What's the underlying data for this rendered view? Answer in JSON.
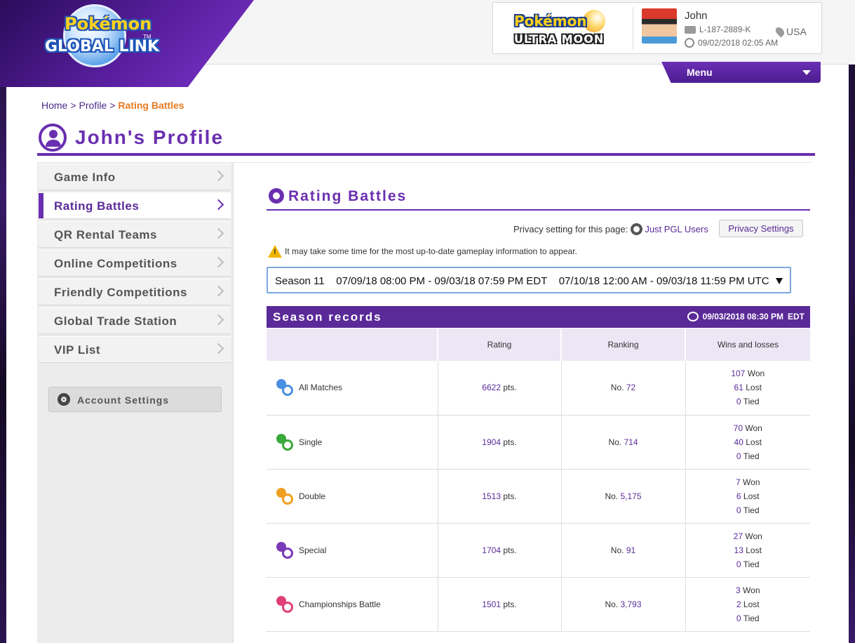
{
  "brand": {
    "logo_line1": "Pokémon",
    "logo_line2": "GLOBAL LINK",
    "logo_tm": "TM",
    "game_line1": "Pokémon",
    "game_line2": "ULTRA MOON"
  },
  "user": {
    "name": "John",
    "id": "L-187-2889-K",
    "country": "USA",
    "timestamp": "09/02/2018 02:05 AM"
  },
  "menu": {
    "label": "Menu"
  },
  "breadcrumb": {
    "home": "Home",
    "profile": "Profile",
    "current": "Rating Battles",
    "sep": ">"
  },
  "profile": {
    "title": "John's Profile"
  },
  "sidebar": {
    "items": [
      {
        "label": "Game Info"
      },
      {
        "label": "Rating Battles"
      },
      {
        "label": "QR Rental Teams"
      },
      {
        "label": "Online Competitions"
      },
      {
        "label": "Friendly Competitions"
      },
      {
        "label": "Global Trade Station"
      },
      {
        "label": "VIP List"
      }
    ],
    "active_index": 1,
    "account_settings": "Account Settings"
  },
  "section": {
    "title": "Rating Battles",
    "privacy_label": "Privacy setting for this page:",
    "privacy_value": "Just PGL Users",
    "privacy_button": "Privacy Settings",
    "warning": "It may take some time for the most up-to-date gameplay information to appear."
  },
  "season": {
    "selected": "Season 11    07/09/18 08:00 PM - 09/03/18 07:59 PM EDT    07/10/18 12:00 AM - 09/03/18 11:59 PM UTC"
  },
  "records": {
    "title": "Season records",
    "stamp_date": "09/03/2018 08:30 PM",
    "stamp_tz": "EDT",
    "columns": [
      "",
      "Rating",
      "Ranking",
      "Wins and losses"
    ],
    "rows": [
      {
        "category": "All Matches",
        "rating": "6622",
        "ranking": "72",
        "won": "107",
        "lost": "61",
        "tied": "0",
        "icon_color": "#4a8fe0"
      },
      {
        "category": "Single",
        "rating": "1904",
        "ranking": "714",
        "won": "70",
        "lost": "40",
        "tied": "0",
        "icon_color": "#3aa83a"
      },
      {
        "category": "Double",
        "rating": "1513",
        "ranking": "5,175",
        "won": "7",
        "lost": "6",
        "tied": "0",
        "icon_color": "#f0a020"
      },
      {
        "category": "Special",
        "rating": "1704",
        "ranking": "91",
        "won": "27",
        "lost": "13",
        "tied": "0",
        "icon_color": "#7a3ab8"
      },
      {
        "category": "Championships Battle",
        "rating": "1501",
        "ranking": "3,793",
        "won": "3",
        "lost": "2",
        "tied": "0",
        "icon_color": "#e0407a"
      }
    ],
    "units": {
      "pts": "pts.",
      "no": "No.",
      "won": "Won",
      "lost": "Lost",
      "tied": "Tied"
    }
  },
  "colors": {
    "accent": "#6a2fb0",
    "accent_dark": "#5a2a98",
    "breadcrumb_current": "#e77a20",
    "warning": "#f0b400"
  }
}
